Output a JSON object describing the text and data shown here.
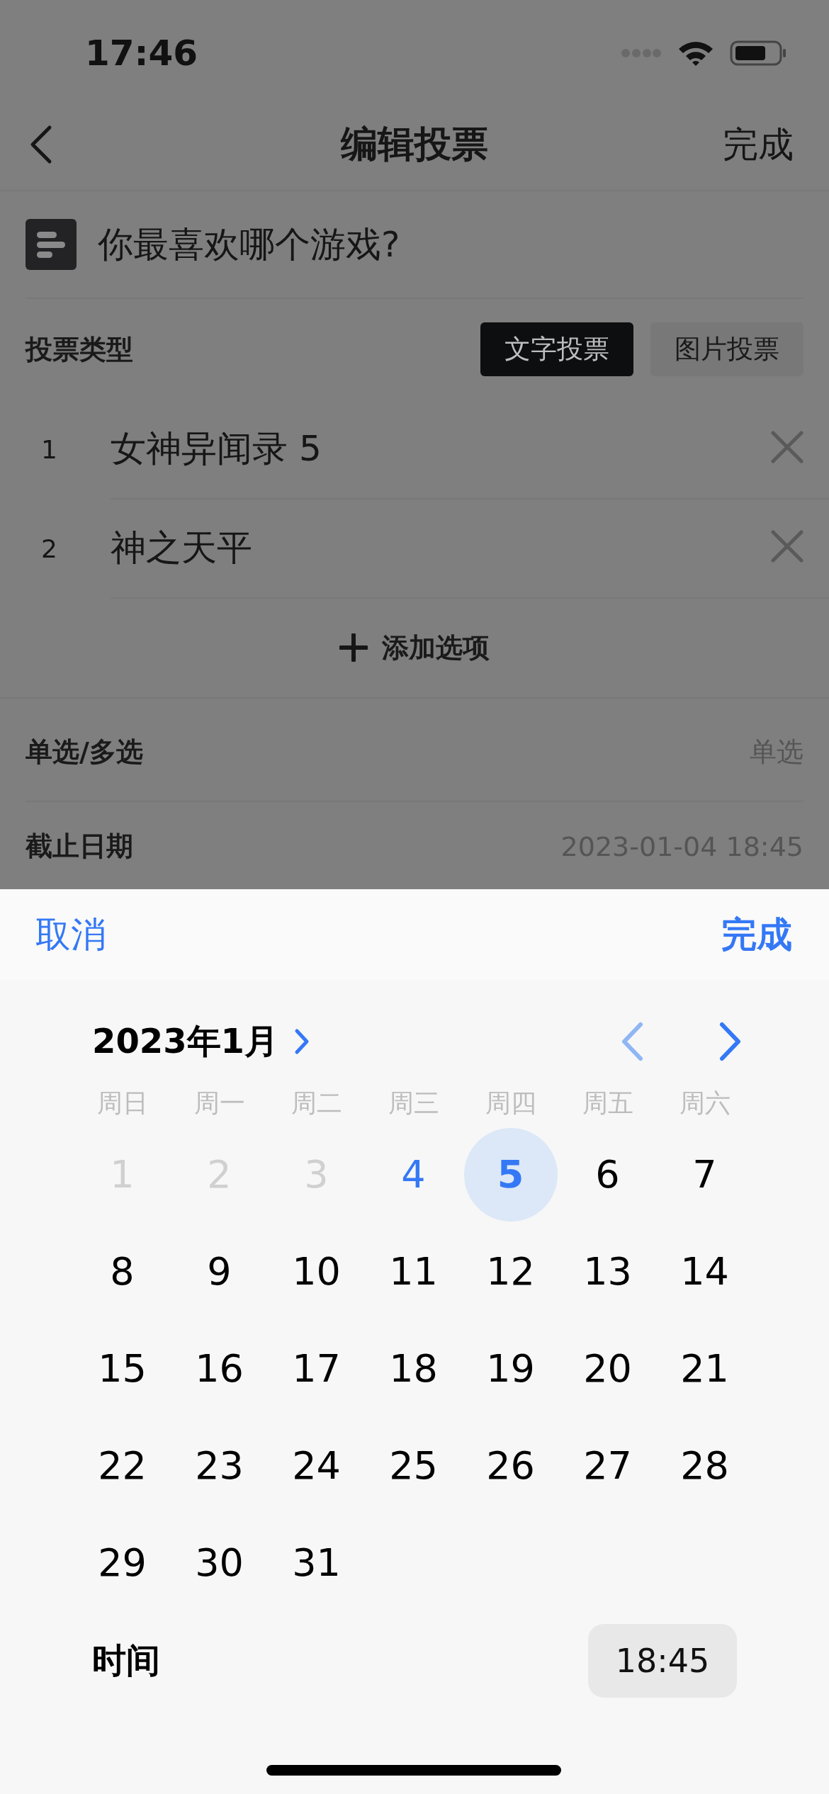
{
  "status_bar": {
    "time": "17:46"
  },
  "nav": {
    "title": "编辑投票",
    "done": "完成"
  },
  "question": "你最喜欢哪个游戏?",
  "vote_type": {
    "label": "投票类型",
    "options": [
      {
        "label": "文字投票",
        "selected": true
      },
      {
        "label": "图片投票",
        "selected": false
      }
    ]
  },
  "options": [
    {
      "index": "1",
      "text": "女神异闻录 5"
    },
    {
      "index": "2",
      "text": "神之天平"
    }
  ],
  "add_option": "添加选项",
  "settings": [
    {
      "label": "单选/多选",
      "value": "单选"
    },
    {
      "label": "截止日期",
      "value": "2023-01-04 18:45"
    }
  ],
  "picker": {
    "cancel": "取消",
    "done": "完成",
    "month": "2023年1月",
    "weekdays": [
      "周日",
      "周一",
      "周二",
      "周三",
      "周四",
      "周五",
      "周六"
    ],
    "days": [
      {
        "label": "1",
        "disabled": true,
        "today": false,
        "selected": false
      },
      {
        "label": "2",
        "disabled": true,
        "today": false,
        "selected": false
      },
      {
        "label": "3",
        "disabled": true,
        "today": false,
        "selected": false
      },
      {
        "label": "4",
        "disabled": false,
        "today": true,
        "selected": false
      },
      {
        "label": "5",
        "disabled": false,
        "today": false,
        "selected": true
      },
      {
        "label": "6",
        "disabled": false,
        "today": false,
        "selected": false
      },
      {
        "label": "7",
        "disabled": false,
        "today": false,
        "selected": false
      },
      {
        "label": "8",
        "disabled": false,
        "today": false,
        "selected": false
      },
      {
        "label": "9",
        "disabled": false,
        "today": false,
        "selected": false
      },
      {
        "label": "10",
        "disabled": false,
        "today": false,
        "selected": false
      },
      {
        "label": "11",
        "disabled": false,
        "today": false,
        "selected": false
      },
      {
        "label": "12",
        "disabled": false,
        "today": false,
        "selected": false
      },
      {
        "label": "13",
        "disabled": false,
        "today": false,
        "selected": false
      },
      {
        "label": "14",
        "disabled": false,
        "today": false,
        "selected": false
      },
      {
        "label": "15",
        "disabled": false,
        "today": false,
        "selected": false
      },
      {
        "label": "16",
        "disabled": false,
        "today": false,
        "selected": false
      },
      {
        "label": "17",
        "disabled": false,
        "today": false,
        "selected": false
      },
      {
        "label": "18",
        "disabled": false,
        "today": false,
        "selected": false
      },
      {
        "label": "19",
        "disabled": false,
        "today": false,
        "selected": false
      },
      {
        "label": "20",
        "disabled": false,
        "today": false,
        "selected": false
      },
      {
        "label": "21",
        "disabled": false,
        "today": false,
        "selected": false
      },
      {
        "label": "22",
        "disabled": false,
        "today": false,
        "selected": false
      },
      {
        "label": "23",
        "disabled": false,
        "today": false,
        "selected": false
      },
      {
        "label": "24",
        "disabled": false,
        "today": false,
        "selected": false
      },
      {
        "label": "25",
        "disabled": false,
        "today": false,
        "selected": false
      },
      {
        "label": "26",
        "disabled": false,
        "today": false,
        "selected": false
      },
      {
        "label": "27",
        "disabled": false,
        "today": false,
        "selected": false
      },
      {
        "label": "28",
        "disabled": false,
        "today": false,
        "selected": false
      },
      {
        "label": "29",
        "disabled": false,
        "today": false,
        "selected": false
      },
      {
        "label": "30",
        "disabled": false,
        "today": false,
        "selected": false
      },
      {
        "label": "31",
        "disabled": false,
        "today": false,
        "selected": false
      }
    ],
    "time_label": "时间",
    "time": "18:45"
  }
}
